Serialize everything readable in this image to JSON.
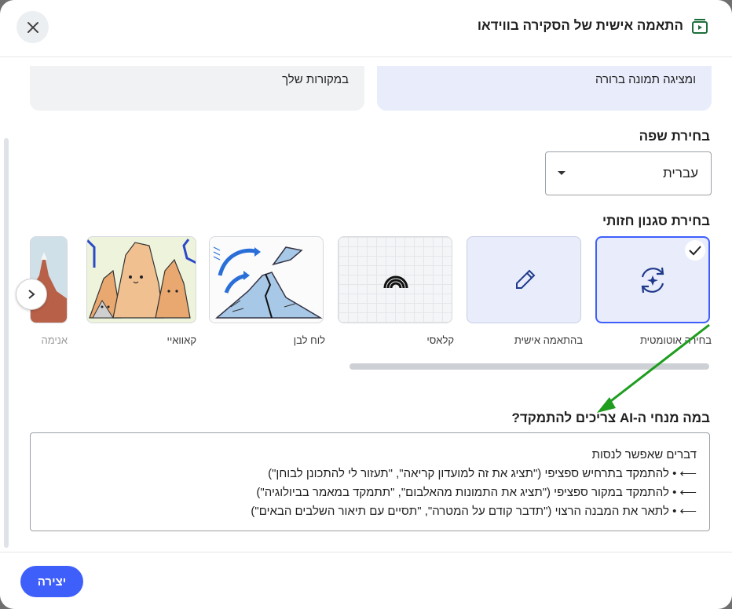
{
  "header": {
    "title": "התאמה אישית של הסקירה בווידאו",
    "close_icon": "close-icon",
    "video_icon": "video-icon"
  },
  "cards": {
    "right_text": "ומציגה תמונה ברורה",
    "left_text": "במקורות שלך"
  },
  "language": {
    "label": "בחירת שפה",
    "selected": "עברית"
  },
  "visual_style": {
    "label": "בחירת סגנון חזותי",
    "options": [
      {
        "label": "בחירה אוטומטית",
        "icon": "auto-refresh-icon",
        "selected": true
      },
      {
        "label": "בהתאמה אישית",
        "icon": "pencil-icon",
        "selected": false
      },
      {
        "label": "קלאסי",
        "icon": "wave-icon",
        "selected": false
      },
      {
        "label": "לוח לבן",
        "icon": "whiteboard-illustration",
        "selected": false
      },
      {
        "label": "קאוואיי",
        "icon": "kawaii-illustration",
        "selected": false
      },
      {
        "label": "אנימה",
        "icon": "anime-illustration",
        "selected": false
      }
    ]
  },
  "focus": {
    "label": "במה מנחי ה-AI צריכים להתמקד?",
    "placeholder_title": "דברים שאפשר לנסות",
    "placeholder_lines": [
      "⟵ • להתמקד בתרחיש ספציפי (\"תציג את זה למועדון קריאה\", \"תעזור לי להתכונן לבוחן\")",
      "⟵ • להתמקד במקור ספציפי (\"תציג את התמונות מהאלבום\", \"תתמקד במאמר בביולוגיה\")",
      "⟵ • לתאר את המבנה הרצוי (\"תדבר קודם על המטרה\", \"תסיים עם תיאור השלבים הבאים\")"
    ]
  },
  "footer": {
    "create_label": "יצירה"
  },
  "colors": {
    "accent": "#3f5ffb",
    "selected_tile": "#e9ecfb",
    "annotation_arrow": "#1f9d1f"
  }
}
